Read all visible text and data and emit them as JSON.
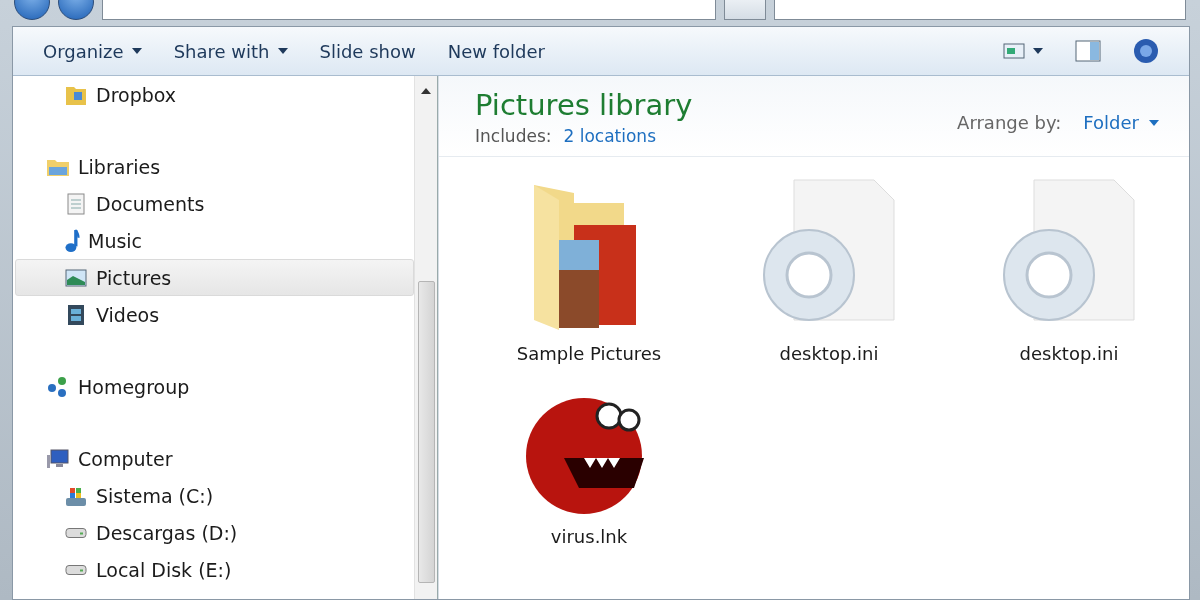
{
  "toolbar": {
    "buttons": [
      {
        "label": "Organize",
        "dropdown": true
      },
      {
        "label": "Share with",
        "dropdown": true
      },
      {
        "label": "Slide show",
        "dropdown": false
      },
      {
        "label": "New folder",
        "dropdown": false
      }
    ]
  },
  "nav": [
    {
      "children": [
        {
          "label": "Dropbox",
          "kind": "dropbox",
          "selected": false
        }
      ]
    },
    {
      "label": "Libraries",
      "kind": "libraries",
      "selected": false,
      "children": [
        {
          "label": "Documents",
          "kind": "documents",
          "selected": false
        },
        {
          "label": "Music",
          "kind": "music",
          "selected": false
        },
        {
          "label": "Pictures",
          "kind": "pictures",
          "selected": true
        },
        {
          "label": "Videos",
          "kind": "videos",
          "selected": false
        }
      ]
    },
    {
      "label": "Homegroup",
      "kind": "homegroup",
      "selected": false
    },
    {
      "label": "Computer",
      "kind": "computer",
      "selected": false,
      "children": [
        {
          "label": "Sistema (C:)",
          "kind": "sysdrive",
          "selected": false
        },
        {
          "label": "Descargas (D:)",
          "kind": "drive",
          "selected": false
        },
        {
          "label": "Local Disk (E:)",
          "kind": "drive",
          "selected": false
        }
      ]
    }
  ],
  "library": {
    "title": "Pictures library",
    "includes_label": "Includes:",
    "includes_link": "2 locations",
    "arrange_label": "Arrange by:",
    "arrange_value": "Folder"
  },
  "items": [
    {
      "name": "Sample Pictures",
      "kind": "folder"
    },
    {
      "name": "desktop.ini",
      "kind": "settings-file"
    },
    {
      "name": "desktop.ini",
      "kind": "settings-file"
    },
    {
      "name": "virus.lnk",
      "kind": "monster"
    }
  ]
}
